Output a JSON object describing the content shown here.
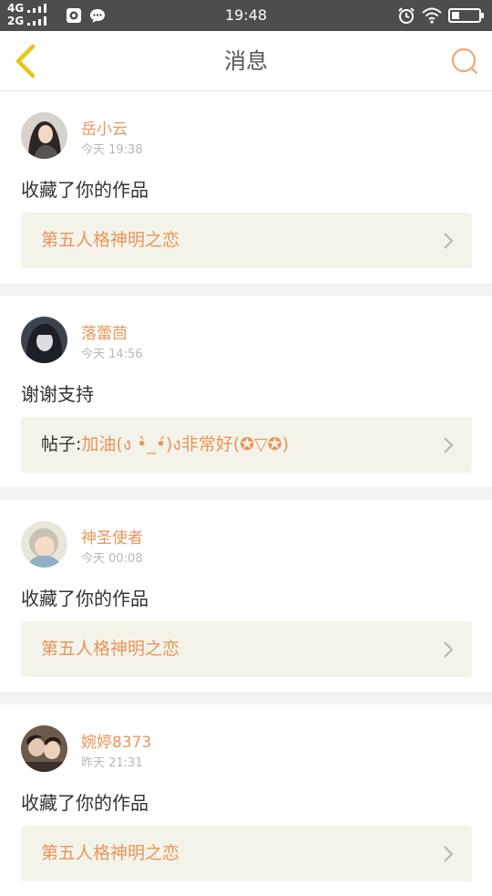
{
  "status_bar": {
    "network_top": "4G",
    "network_bottom": "2G",
    "time": "19:48",
    "icons": [
      "signal-icon",
      "app-notification-icon",
      "chat-bubble-icon",
      "alarm-icon",
      "wifi-icon",
      "battery-icon"
    ]
  },
  "header": {
    "title": "消息",
    "back_icon": "chevron-left-icon",
    "search_icon": "search-icon"
  },
  "colors": {
    "accent": "#e9955b",
    "back_icon": "#e6c419",
    "target_bg": "#f3f3ea",
    "separator": "#f2f2f2"
  },
  "messages": [
    {
      "name": "岳小云",
      "time": "今天 19:38",
      "action": "收藏了你的作品",
      "target_prefix": "",
      "target": "第五人格神明之恋"
    },
    {
      "name": "落蕾茴",
      "time": "今天 14:56",
      "action": "谢谢支持",
      "target_prefix": "帖子:",
      "target": "加油(ง •̀_•́)ง非常好(✪▽✪)"
    },
    {
      "name": "神圣使者",
      "time": "今天 00:08",
      "action": "收藏了你的作品",
      "target_prefix": "",
      "target": "第五人格神明之恋"
    },
    {
      "name": "婉婷8373",
      "time": "昨天 21:31",
      "action": "收藏了你的作品",
      "target_prefix": "",
      "target": "第五人格神明之恋"
    }
  ]
}
